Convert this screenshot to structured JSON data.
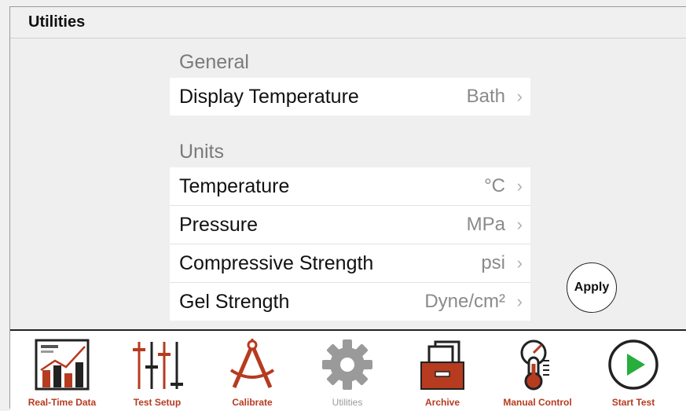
{
  "header": {
    "title": "Utilities"
  },
  "general": {
    "title": "General",
    "rows": [
      {
        "label": "Display Temperature",
        "value": "Bath"
      }
    ]
  },
  "units": {
    "title": "Units",
    "rows": [
      {
        "label": "Temperature",
        "value": "°C"
      },
      {
        "label": "Pressure",
        "value": "MPa"
      },
      {
        "label": "Compressive Strength",
        "value": "psi"
      },
      {
        "label": "Gel Strength",
        "value": "Dyne/cm²"
      }
    ]
  },
  "apply_label": "Apply",
  "toolbar": {
    "items": [
      {
        "label": "Real-Time Data",
        "icon": "chart-icon"
      },
      {
        "label": "Test Setup",
        "icon": "sliders-icon"
      },
      {
        "label": "Calibrate",
        "icon": "compass-icon"
      },
      {
        "label": "Utilities",
        "icon": "gear-icon"
      },
      {
        "label": "Archive",
        "icon": "archive-box-icon"
      },
      {
        "label": "Manual Control",
        "icon": "thermometer-gauge-icon"
      },
      {
        "label": "Start Test",
        "icon": "play-icon"
      }
    ]
  },
  "colors": {
    "accent": "#b63b1f",
    "dark": "#222222",
    "play_green": "#27ae3d",
    "disabled": "#9a9a9a"
  }
}
